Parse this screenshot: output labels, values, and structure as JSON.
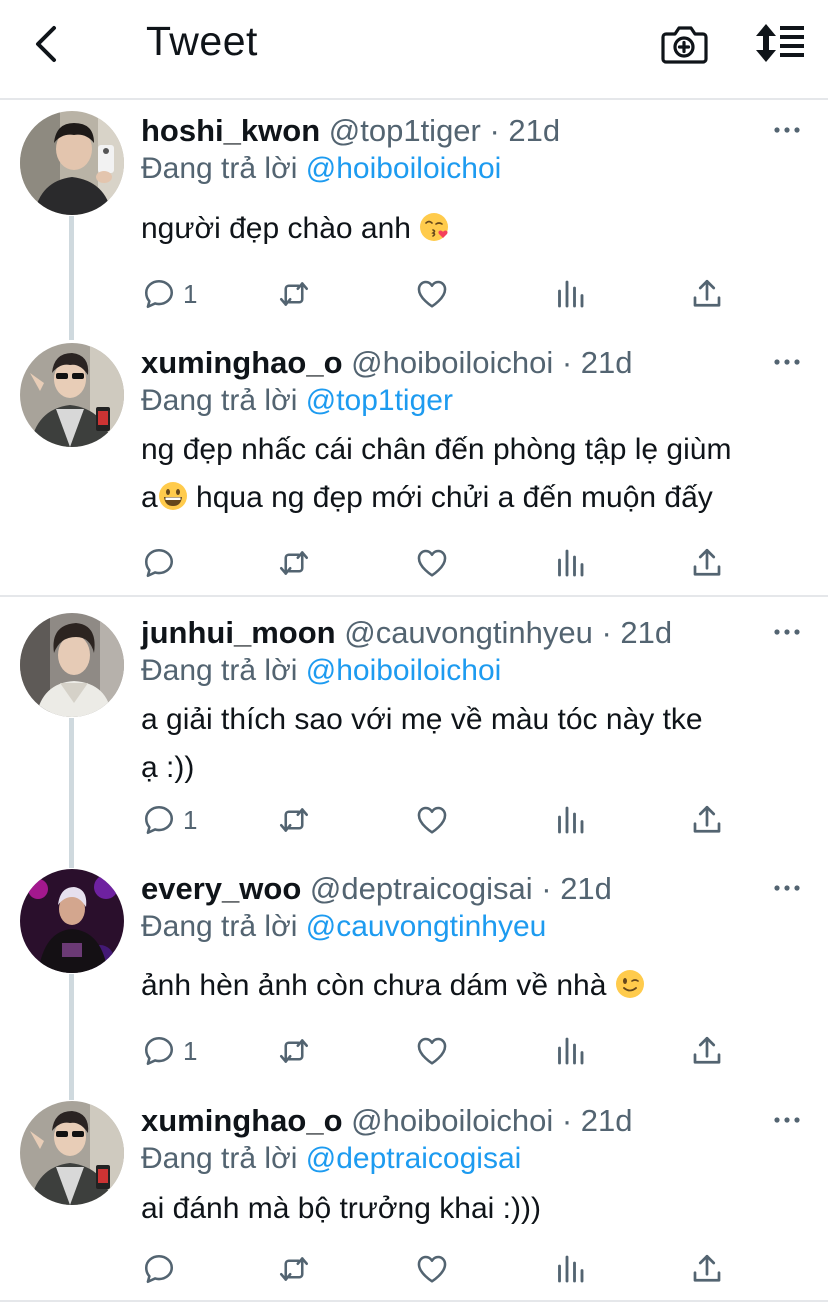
{
  "header": {
    "title": "Tweet"
  },
  "reply_prefix": "Đang trả lời",
  "tweets": [
    {
      "display_name": "hoshi_kwon",
      "handle_time": "@top1tiger · 21d",
      "reply_to": "@hoiboiloichoi",
      "text_line1": "người đẹp chào anh",
      "text_line2": "",
      "emoji": "kissing-face-winking",
      "reply_count": "1"
    },
    {
      "display_name": "xuminghao_o",
      "handle_time": "@hoiboiloichoi · 21d",
      "reply_to": "@top1tiger",
      "text_line1": "ng đẹp nhấc cái chân đến phòng tập lẹ giùm",
      "text_line2_pre": "a",
      "text_line2_post": " hqua ng đẹp mới chửi a đến muộn đấy",
      "emoji": "grinning-face",
      "reply_count": ""
    },
    {
      "display_name": "junhui_moon",
      "handle_time": "@cauvongtinhyeu · 21d",
      "reply_to": "@hoiboiloichoi",
      "text_line1": "a giải thích sao với mẹ về màu tóc này tke",
      "text_line2": "ạ :))",
      "reply_count": "1"
    },
    {
      "display_name": "every_woo",
      "handle_time": "@deptraicogisai · 21d",
      "reply_to": "@cauvongtinhyeu",
      "text_line1": "ảnh hèn ảnh còn chưa dám về nhà",
      "emoji": "winking-face",
      "reply_count": "1"
    },
    {
      "display_name": "xuminghao_o",
      "handle_time": "@hoiboiloichoi · 21d",
      "reply_to": "@deptraicogisai",
      "text_line1": "ai đánh mà bộ trưởng khai :)))",
      "reply_count": ""
    }
  ],
  "colors": {
    "mention": "#1d9bf0",
    "secondary_text": "#536471",
    "thread_line": "#cfd9de",
    "divider": "#e5e7ea"
  }
}
